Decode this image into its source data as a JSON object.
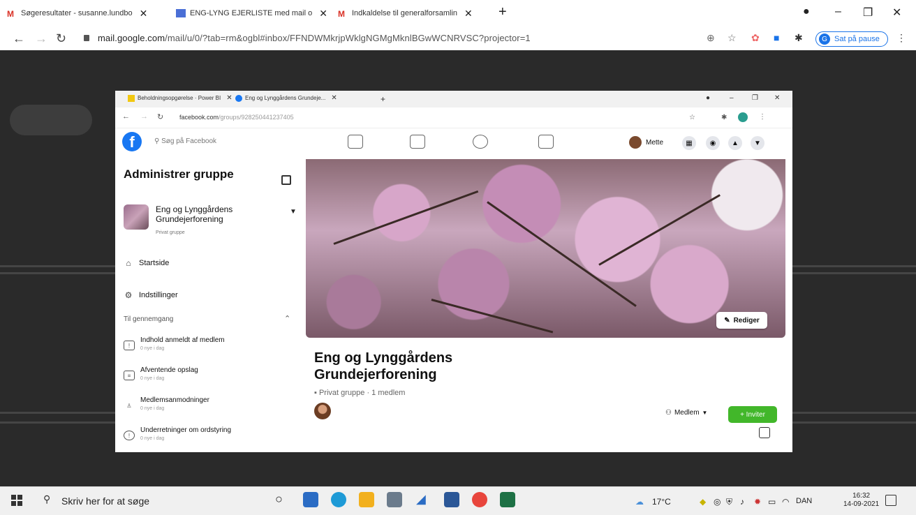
{
  "outer_browser": {
    "tabs": [
      {
        "label": "Søgeresultater - susanne.lundbo"
      },
      {
        "label": "ENG-LYNG EJERLISTE med mail o"
      },
      {
        "label": "Indkaldelse til generalforsamlin"
      }
    ],
    "url_host": "mail.google.com",
    "url_path": "/mail/u/0/?tab=rm&ogbl#inbox/FFNDWMkrjpWklgNGMgMknlBGwWCNRVSC?projector=1",
    "pause_label": "Sat på pause",
    "pause_avatar": "G"
  },
  "inner_browser": {
    "tabs": [
      {
        "label": "Beholdningsopgørelse · Power BI"
      },
      {
        "label": "Eng og Lynggårdens Grundeje..."
      }
    ],
    "url_host": "facebook.com",
    "url_path": "/groups/928250441237405"
  },
  "facebook": {
    "search_placeholder": "Søg på Facebook",
    "profile_name": "Mette",
    "sidebar": {
      "title": "Administrer gruppe",
      "group_name": "Eng og Lynggårdens Grundejerforening",
      "group_privacy": "Privat gruppe",
      "nav": [
        {
          "label": "Startside"
        },
        {
          "label": "Indstillinger"
        }
      ],
      "review_section": "Til gennemgang",
      "review_items": [
        {
          "label": "Indhold anmeldt af medlem",
          "sub": "0 nye i dag"
        },
        {
          "label": "Afventende opslag",
          "sub": "0 nye i dag"
        },
        {
          "label": "Medlemsanmodninger",
          "sub": "0 nye i dag"
        },
        {
          "label": "Underretninger om ordstyring",
          "sub": "0 nye i dag"
        }
      ]
    },
    "main": {
      "edit_label": "Rediger",
      "group_title": "Eng og Lynggårdens Grundejerforening",
      "group_meta": "Privat gruppe · 1 medlem",
      "members_label": "Medlem",
      "invite_label": "+ Inviter"
    }
  },
  "taskbar": {
    "search_placeholder": "Skriv her for at søge",
    "temperature": "17°C",
    "language": "DAN",
    "time": "16:32",
    "date": "14-09-2021"
  },
  "colors": {
    "facebook_blue": "#1877f2",
    "invite_green": "#42b72a",
    "chrome_blue": "#1a73e8"
  }
}
